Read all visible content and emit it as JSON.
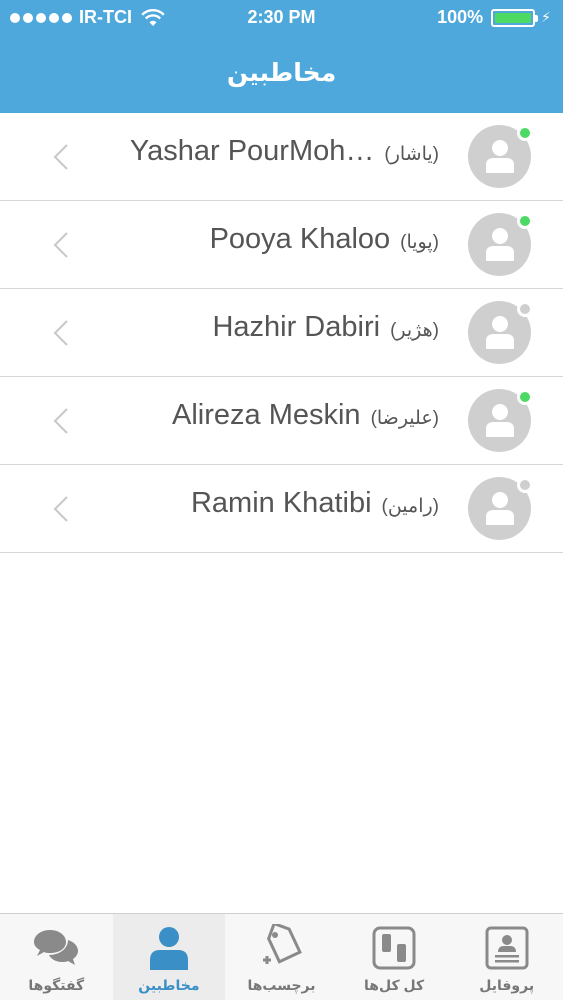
{
  "status_bar": {
    "carrier": "IR-TCI",
    "time": "2:30 PM",
    "battery": "100%"
  },
  "nav": {
    "title": "مخاطبین"
  },
  "contacts": [
    {
      "name": "Yashar PourMoh…",
      "fa_name": "(یاشار)",
      "status": "online"
    },
    {
      "name": "Pooya Khaloo",
      "fa_name": "(پویا)",
      "status": "online"
    },
    {
      "name": "Hazhir Dabiri",
      "fa_name": "(هژیر)",
      "status": "offline"
    },
    {
      "name": "Alireza Meskin",
      "fa_name": "(علیرضا)",
      "status": "online"
    },
    {
      "name": "Ramin Khatibi",
      "fa_name": "(رامین)",
      "status": "offline"
    }
  ],
  "tabs": [
    {
      "label": "گفتگوها",
      "icon": "chat-bubbles-icon",
      "active": false
    },
    {
      "label": "مخاطبین",
      "icon": "person-icon",
      "active": true
    },
    {
      "label": "برچسب‌ها",
      "icon": "tag-icon",
      "active": false
    },
    {
      "label": "کل کل‌ها",
      "icon": "versus-icon",
      "active": false
    },
    {
      "label": "پروفایل",
      "icon": "profile-card-icon",
      "active": false
    }
  ],
  "colors": {
    "header": "#4ea8dc",
    "online": "#4cd964",
    "offline": "#cfcfcf",
    "active_tab": "#3a8fc7"
  }
}
